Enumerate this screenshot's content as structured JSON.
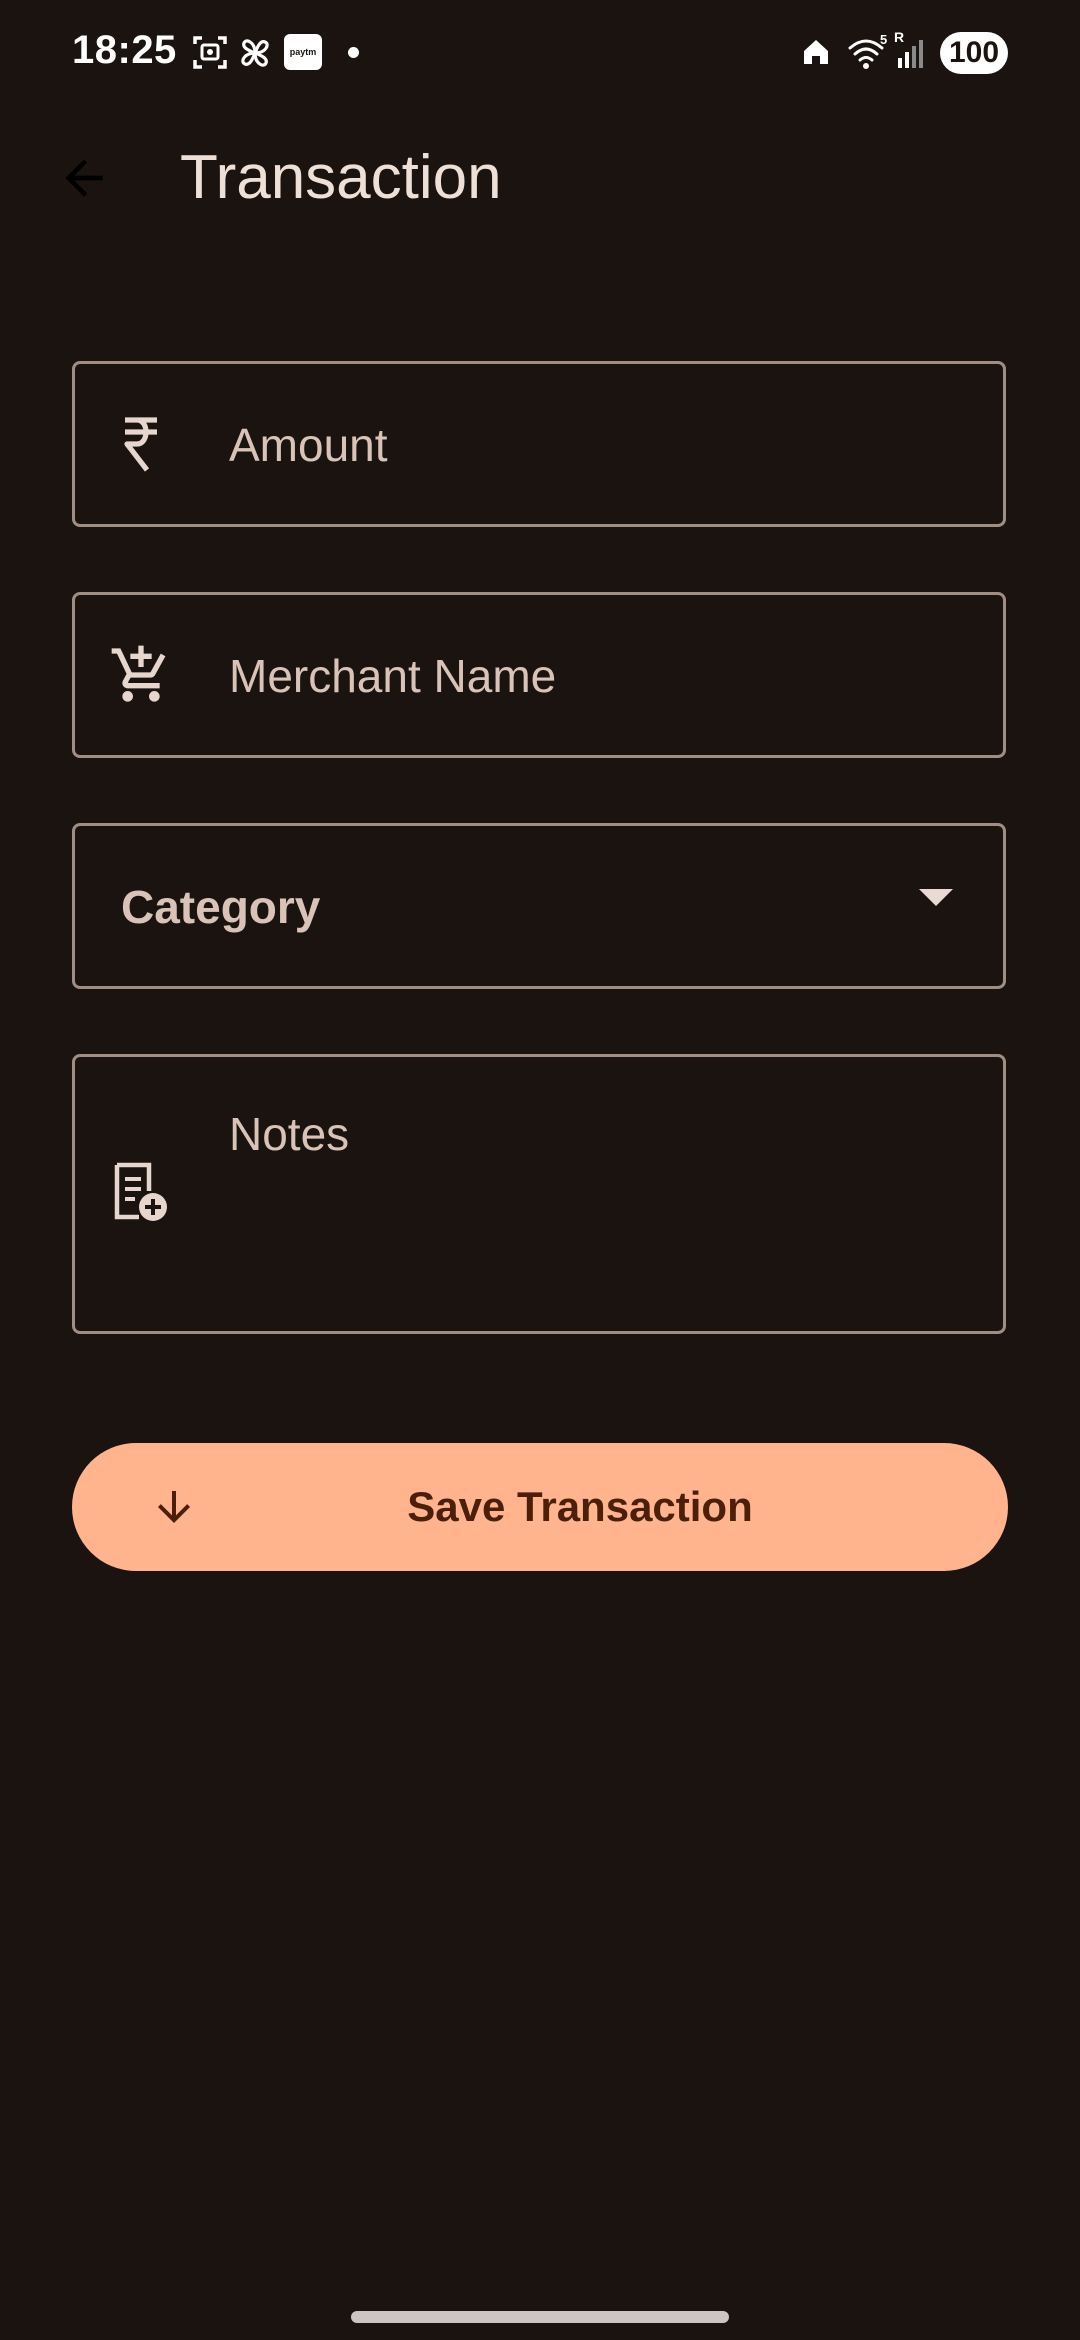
{
  "status_bar": {
    "time": "18:25",
    "paytm_label": "paytm",
    "battery": "100",
    "wifi_label": "5",
    "signal_label": "R"
  },
  "app_bar": {
    "title": "Transaction",
    "back_icon": "arrow-back-icon"
  },
  "form": {
    "amount": {
      "label": "Amount",
      "icon": "rupee-icon"
    },
    "merchant": {
      "label": "Merchant Name",
      "icon": "add-shopping-cart-icon"
    },
    "category": {
      "label": "Category",
      "icon": "dropdown-arrow-icon"
    },
    "notes": {
      "label": "Notes",
      "icon": "note-add-icon"
    }
  },
  "save_button": {
    "label": "Save Transaction",
    "icon": "arrow-down-icon"
  },
  "colors": {
    "background": "#1a1310",
    "accent": "#ffb48e",
    "accent_text": "#4b1f0a",
    "outline": "#a08d84",
    "label": "#d9c3b8"
  }
}
